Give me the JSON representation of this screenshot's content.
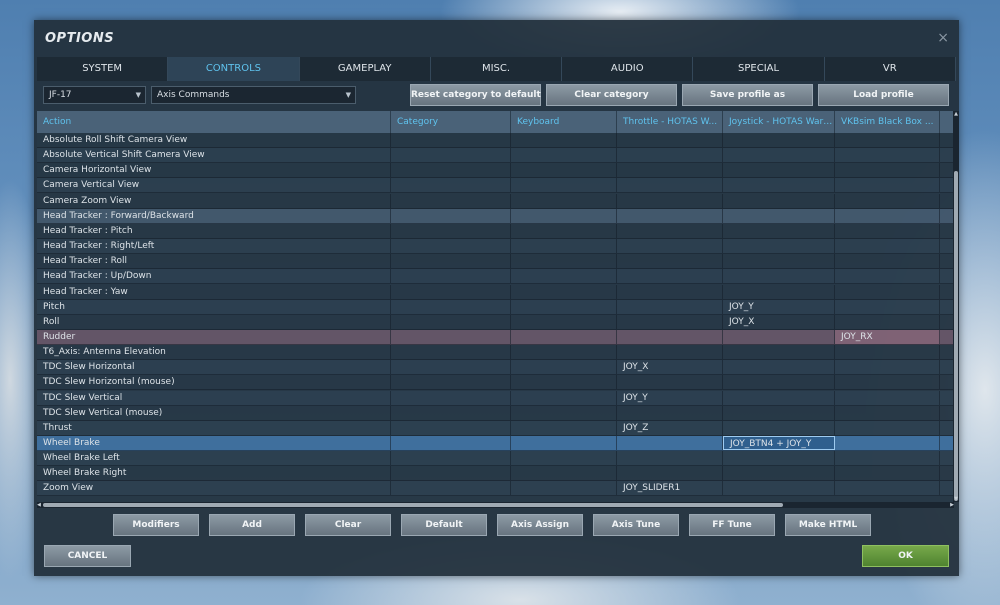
{
  "window": {
    "title": "OPTIONS",
    "close": "×"
  },
  "tabs": [
    "SYSTEM",
    "CONTROLS",
    "GAMEPLAY",
    "MISC.",
    "AUDIO",
    "SPECIAL",
    "VR"
  ],
  "active_tab": "CONTROLS",
  "toolbar": {
    "aircraft_select": "JF-17",
    "category_select": "Axis Commands",
    "reset_label": "Reset category to default",
    "clear_label": "Clear category",
    "save_label": "Save profile as",
    "load_label": "Load profile"
  },
  "table": {
    "headers": [
      "Action",
      "Category",
      "Keyboard",
      "Throttle - HOTAS W...",
      "Joystick - HOTAS Wart...",
      "VKBsim Black Box  ..."
    ],
    "rows": [
      {
        "action": "Absolute Roll Shift Camera View",
        "throttle": "",
        "joystick": "",
        "vkb": ""
      },
      {
        "action": "Absolute Vertical Shift Camera View",
        "throttle": "",
        "joystick": "",
        "vkb": ""
      },
      {
        "action": "Camera Horizontal View",
        "throttle": "",
        "joystick": "",
        "vkb": ""
      },
      {
        "action": "Camera Vertical View",
        "throttle": "",
        "joystick": "",
        "vkb": ""
      },
      {
        "action": "Camera Zoom View",
        "throttle": "",
        "joystick": "",
        "vkb": ""
      },
      {
        "action": "Head Tracker : Forward/Backward",
        "throttle": "",
        "joystick": "",
        "vkb": ""
      },
      {
        "action": "Head Tracker : Pitch",
        "throttle": "",
        "joystick": "",
        "vkb": ""
      },
      {
        "action": "Head Tracker : Right/Left",
        "throttle": "",
        "joystick": "",
        "vkb": ""
      },
      {
        "action": "Head Tracker : Roll",
        "throttle": "",
        "joystick": "",
        "vkb": ""
      },
      {
        "action": "Head Tracker : Up/Down",
        "throttle": "",
        "joystick": "",
        "vkb": ""
      },
      {
        "action": "Head Tracker : Yaw",
        "throttle": "",
        "joystick": "",
        "vkb": ""
      },
      {
        "action": "Pitch",
        "throttle": "",
        "joystick": "JOY_Y",
        "vkb": ""
      },
      {
        "action": "Roll",
        "throttle": "",
        "joystick": "JOY_X",
        "vkb": ""
      },
      {
        "action": "Rudder",
        "throttle": "",
        "joystick": "",
        "vkb": "JOY_RX"
      },
      {
        "action": "T6_Axis: Antenna Elevation",
        "throttle": "",
        "joystick": "",
        "vkb": ""
      },
      {
        "action": "TDC Slew Horizontal",
        "throttle": "JOY_X",
        "joystick": "",
        "vkb": ""
      },
      {
        "action": "TDC Slew Horizontal (mouse)",
        "throttle": "",
        "joystick": "",
        "vkb": ""
      },
      {
        "action": "TDC Slew Vertical",
        "throttle": "JOY_Y",
        "joystick": "",
        "vkb": ""
      },
      {
        "action": "TDC Slew Vertical (mouse)",
        "throttle": "",
        "joystick": "",
        "vkb": ""
      },
      {
        "action": "Thrust",
        "throttle": "JOY_Z",
        "joystick": "",
        "vkb": ""
      },
      {
        "action": "Wheel Brake",
        "throttle": "",
        "joystick": "JOY_BTN4 + JOY_Y",
        "vkb": ""
      },
      {
        "action": "Wheel Brake Left",
        "throttle": "",
        "joystick": "",
        "vkb": ""
      },
      {
        "action": "Wheel Brake Right",
        "throttle": "",
        "joystick": "",
        "vkb": ""
      },
      {
        "action": "Zoom View",
        "throttle": "JOY_SLIDER1",
        "joystick": "",
        "vkb": ""
      }
    ]
  },
  "bottom_buttons": [
    "Modifiers",
    "Add",
    "Clear",
    "Default",
    "Axis Assign",
    "Axis Tune",
    "FF Tune",
    "Make HTML"
  ],
  "footer": {
    "cancel": "CANCEL",
    "ok": "OK"
  },
  "colors": {
    "accent": "#5fc3ee",
    "ok_green": "#5f9a3a",
    "window_bg": "#22303c"
  }
}
